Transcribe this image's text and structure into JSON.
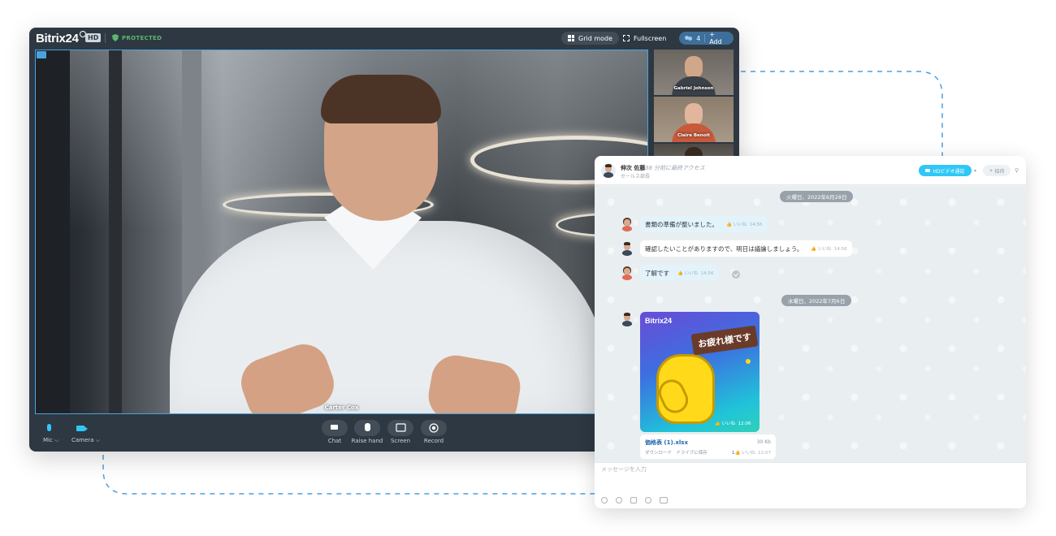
{
  "call": {
    "logo": "Bitrix24",
    "hd_badge": "HD",
    "protected_label": "PROTECTED",
    "grid_mode_label": "Grid mode",
    "fullscreen_label": "Fullscreen",
    "participants_count": "4",
    "add_label": "+ Add",
    "main_speaker": "Carter Cox",
    "thumbnails": [
      {
        "name": "Gabriel Johnson"
      },
      {
        "name": "Claire Benoit"
      }
    ],
    "controls": {
      "mic": "Mic",
      "camera": "Camera",
      "chat": "Chat",
      "raise_hand": "Raise hand",
      "screen": "Screen",
      "record": "Record"
    }
  },
  "chat": {
    "header": {
      "name": "伸次 佐藤",
      "last_seen": "38 分前に最終アクセス",
      "role": "セールス部長",
      "hd_call_label": "HDビデオ通話",
      "invite_label": "招待"
    },
    "messages": [
      {
        "date": "火曜日、2022年6月28日"
      },
      {
        "sender": "female",
        "text": "書類の準備が整いました。",
        "like": "いいね",
        "time": "14:56"
      },
      {
        "sender": "male",
        "text": "確認したいことがありますので、明日は議論しましょう。",
        "like": "いいね",
        "time": "14:56"
      },
      {
        "sender": "female",
        "text": "了解です",
        "like": "いいね",
        "time": "14:56"
      },
      {
        "date": "水曜日、2022年7月6日"
      }
    ],
    "sticker": {
      "logo": "Bitrix24",
      "banner": "お疲れ様です",
      "like": "いいね",
      "time": "12:06"
    },
    "file": {
      "name": "価格表 (1).xlsx",
      "size": "30 Kb",
      "download": "ダウンロード",
      "save_drive": "ドライブに保存",
      "likes": "1",
      "like": "いいね",
      "time": "12:07"
    },
    "input_placeholder": "メッセージを入力"
  },
  "colors": {
    "accent": "#2fc7f7",
    "call_bg": "#2e3842",
    "connector": "#4a9fe0"
  }
}
